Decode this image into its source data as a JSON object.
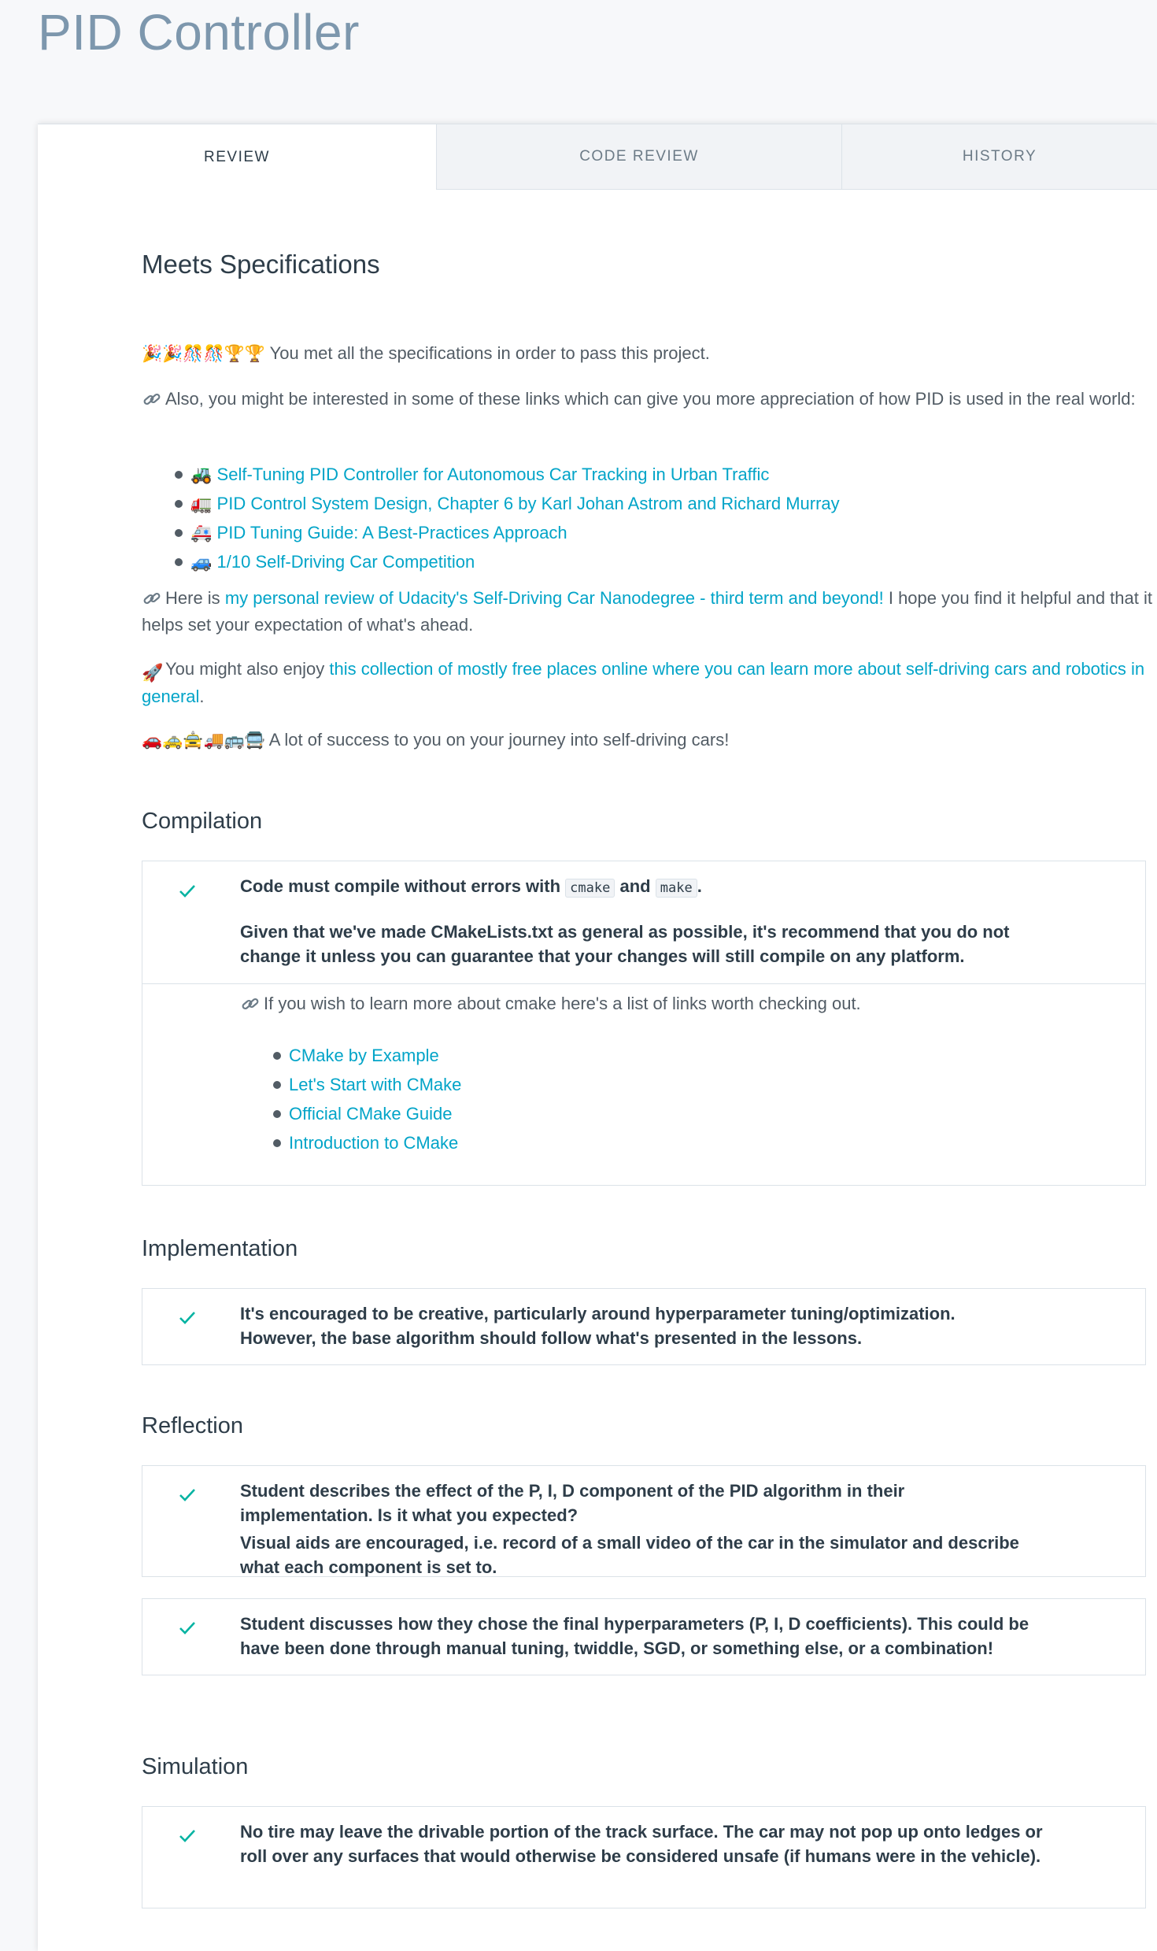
{
  "page": {
    "title": "PID Controller"
  },
  "tabs": [
    {
      "label": "REVIEW",
      "active": true
    },
    {
      "label": "CODE REVIEW",
      "active": false
    },
    {
      "label": "HISTORY",
      "active": false
    }
  ],
  "summary": {
    "heading": "Meets Specifications",
    "intro_emojis": "🎉🎉🎊🎊🏆🏆",
    "intro_text": "You met all the specifications in order to pass this project.",
    "links_intro": "Also, you might be interested in some of these links which can give you more appreciation of how PID is used in the real world:",
    "links": [
      {
        "emoji": "🚜",
        "label": "Self-Tuning PID Controller for Autonomous Car Tracking in Urban Traffic"
      },
      {
        "emoji": "🚛",
        "label": "PID Control System Design, Chapter 6 by Karl Johan Astrom and Richard Murray"
      },
      {
        "emoji": "🚑",
        "label": "PID Tuning Guide: A Best-Practices Approach"
      },
      {
        "emoji": "🚙",
        "label": "1/10 Self-Driving Car Competition"
      }
    ],
    "review_prefix": "Here is",
    "review_link": "my personal review of Udacity's Self-Driving Car Nanodegree - third term and beyond!",
    "review_suffix": "I hope you find it helpful and that it helps set your expectation of what's ahead.",
    "enjoy_prefix": "You might also enjoy",
    "enjoy_link": "this collection of mostly free places online where you can learn more about self-driving cars and robotics in general",
    "enjoy_suffix": ".",
    "outro_emojis": "🚗🚕🚖🚚🚌🚍",
    "outro_text": "A lot of success to you on your journey into self-driving cars!"
  },
  "sections": {
    "compilation": {
      "title": "Compilation",
      "criterion_part1": "Code must compile without errors with",
      "code1": "cmake",
      "criterion_and": "and",
      "code2": "make",
      "criterion_end": ".",
      "criterion_detail": "Given that we've made CMakeLists.txt as general as possible, it's recommend that you do not change it unless you can guarantee that your changes will still compile on any platform.",
      "comment_intro": "If you wish to learn more about cmake here's a list of links worth checking out.",
      "comment_links": [
        "CMake by Example",
        "Let's Start with CMake",
        "Official CMake Guide",
        "Introduction to CMake"
      ]
    },
    "implementation": {
      "title": "Implementation",
      "criterion": "It's encouraged to be creative, particularly around hyperparameter tuning/optimization. However, the base algorithm should follow what's presented in the lessons."
    },
    "reflection": {
      "title": "Reflection",
      "criterion1": "Student describes the effect of the P, I, D component of the PID algorithm in their implementation. Is it what you expected?",
      "criterion1_detail": "Visual aids are encouraged, i.e. record of a small video of the car in the simulator and describe what each component is set to.",
      "criterion2": "Student discusses how they chose the final hyperparameters (P, I, D coefficients). This could be have been done through manual tuning, twiddle, SGD, or something else, or a combination!"
    },
    "simulation": {
      "title": "Simulation",
      "criterion": "No tire may leave the drivable portion of the track surface. The car may not pop up onto ledges or roll over any surfaces that would otherwise be considered unsafe (if humans were in the vehicle)."
    }
  },
  "colors": {
    "accent": "#02a4c8",
    "check": "#02b3a2",
    "title": "#7d97ad"
  },
  "icons": {
    "link": "link-icon",
    "rocket": "rocket-icon",
    "check": "checkmark-icon"
  }
}
